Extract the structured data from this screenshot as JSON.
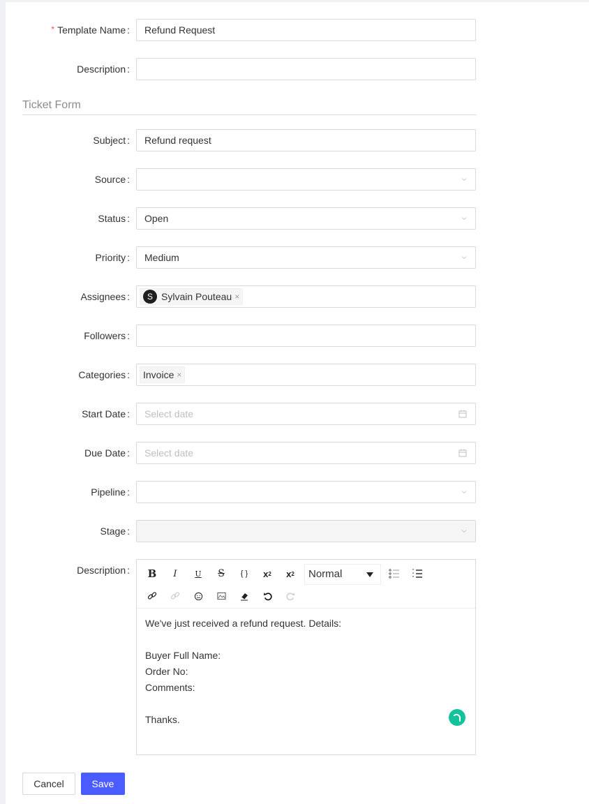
{
  "form": {
    "template_name": {
      "label": "Template Name",
      "required": true,
      "value": "Refund Request"
    },
    "description": {
      "label": "Description",
      "value": ""
    },
    "section_title": "Ticket Form",
    "subject": {
      "label": "Subject",
      "value": "Refund request"
    },
    "source": {
      "label": "Source",
      "value": ""
    },
    "status": {
      "label": "Status",
      "value": "Open"
    },
    "priority": {
      "label": "Priority",
      "value": "Medium"
    },
    "assignees": {
      "label": "Assignees",
      "tags": [
        {
          "initial": "S",
          "name": "Sylvain Pouteau"
        }
      ]
    },
    "followers": {
      "label": "Followers",
      "value": ""
    },
    "categories": {
      "label": "Categories",
      "tags": [
        {
          "name": "Invoice"
        }
      ]
    },
    "start_date": {
      "label": "Start Date",
      "placeholder": "Select date"
    },
    "due_date": {
      "label": "Due Date",
      "placeholder": "Select date"
    },
    "pipeline": {
      "label": "Pipeline",
      "value": ""
    },
    "stage": {
      "label": "Stage",
      "value": "",
      "disabled": true
    },
    "body": {
      "label": "Description",
      "format_select": "Normal",
      "toolbar": [
        "bold",
        "italic",
        "underline",
        "strike",
        "code-block",
        "superscript",
        "subscript",
        "format",
        "bullet-list",
        "ordered-list",
        "link",
        "unlink",
        "emoji",
        "image",
        "clean",
        "undo",
        "redo"
      ],
      "lines": [
        "We've just received a refund request. Details:",
        "",
        "Buyer Full Name:",
        "Order No:",
        "Comments:",
        "",
        "Thanks."
      ]
    }
  },
  "colon": ":",
  "required_mark": "*",
  "remove_glyph": "×",
  "actions": {
    "cancel": "Cancel",
    "save": "Save"
  },
  "colors": {
    "primary": "#4a5bff",
    "required": "#ff4d4f",
    "grammarly": "#15c39a"
  }
}
